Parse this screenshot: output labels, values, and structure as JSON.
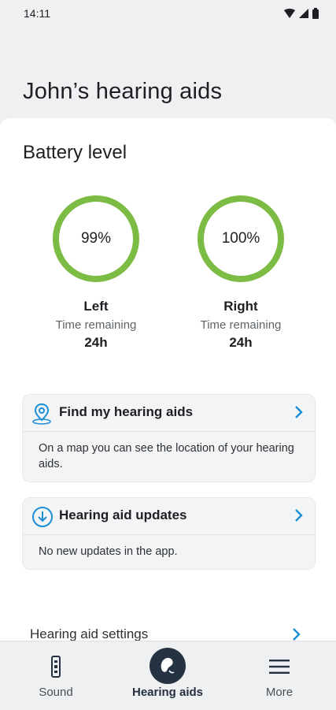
{
  "status": {
    "time": "14:11"
  },
  "header": {
    "title": "John’s hearing aids"
  },
  "battery": {
    "title": "Battery level",
    "left": {
      "percent_text": "99%",
      "percent": 99,
      "side": "Left",
      "remaining_label": "Time remaining",
      "remaining": "24h"
    },
    "right": {
      "percent_text": "100%",
      "percent": 100,
      "side": "Right",
      "remaining_label": "Time remaining",
      "remaining": "24h"
    },
    "ring_color": "#7cbc45"
  },
  "cards": {
    "find": {
      "title": "Find my hearing aids",
      "body": "On a map you can see the location of your hearing aids.",
      "icon": "location-pin-icon"
    },
    "updates": {
      "title": "Hearing aid updates",
      "body": "No new updates in the app.",
      "icon": "download-circle-icon"
    }
  },
  "settings": {
    "label": "Hearing aid settings"
  },
  "nav": {
    "items": [
      {
        "label": "Sound",
        "icon": "remote-control-icon"
      },
      {
        "label": "Hearing aids",
        "icon": "hearing-aid-icon",
        "active": true
      },
      {
        "label": "More",
        "icon": "menu-icon"
      }
    ]
  },
  "colors": {
    "accent": "#1b8fd6",
    "nav_active_bg": "#243241"
  }
}
